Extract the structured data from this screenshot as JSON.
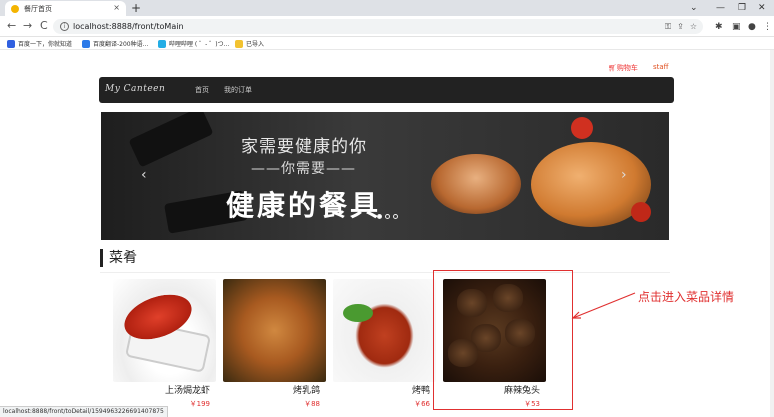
{
  "browser": {
    "tab_title": "餐厅首页",
    "tab_close": "×",
    "new_tab": "+",
    "win_min": "⌄",
    "win_minimize": "—",
    "win_restore": "❐",
    "win_close": "✕",
    "back": "←",
    "forward": "→",
    "reload": "C",
    "url": "localhost:8888/front/toMain",
    "bookmarks": [
      {
        "label": "百度一下，你就知道",
        "color": "#3060e0"
      },
      {
        "label": "百度翻译-200种语...",
        "color": "#2c7ae8"
      },
      {
        "label": "哔哩哔哩 ( ゜- ゜)つ...",
        "color": "#23ade5"
      },
      {
        "label": "已导入",
        "color": "#f2c230"
      }
    ],
    "status_url": "localhost:8888/front/toDetail/1594963226691407875"
  },
  "header": {
    "cart_label": "购物车",
    "staff_label": "staff"
  },
  "navbar": {
    "brand": "My Canteen",
    "links": [
      "首页",
      "我的订单"
    ]
  },
  "carousel": {
    "line1": "家需要健康的你",
    "line2": "——你需要——",
    "line3": "健康的餐具",
    "prev": "‹",
    "next": "›"
  },
  "section": {
    "title": "菜肴"
  },
  "dishes": [
    {
      "name": "上汤焗龙虾",
      "price": "￥199"
    },
    {
      "name": "烤乳鸽",
      "price": "￥88"
    },
    {
      "name": "烤鸭",
      "price": "￥66"
    },
    {
      "name": "麻辣兔头",
      "price": "￥53"
    }
  ],
  "annotation": {
    "text": "点击进入菜品详情",
    "color": "#e03030"
  }
}
